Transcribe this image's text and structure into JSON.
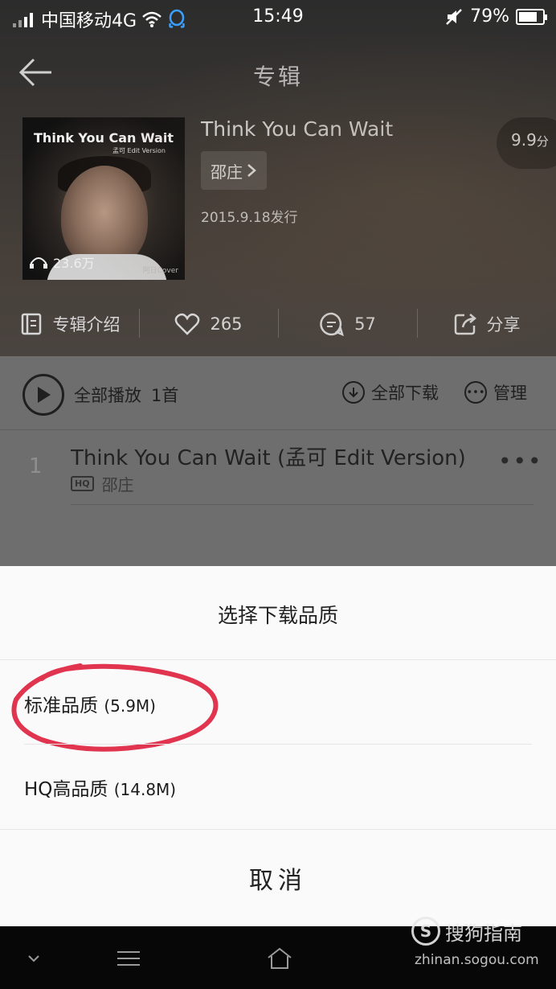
{
  "status_bar": {
    "carrier": "中国移动4G",
    "time": "15:49",
    "battery": "79%",
    "battery_level": 0.79
  },
  "header": {
    "title": "专辑"
  },
  "album": {
    "cover_title": "Think You Can Wait",
    "cover_subtitle": "孟可 Edit Version",
    "cover_mark": "阿日Cover",
    "play_count": "23.6万",
    "name": "Think You Can Wait",
    "artist": "邵庄",
    "release": "2015.9.18发行",
    "score": "9.9",
    "score_unit": "分"
  },
  "actions": {
    "intro": "专辑介绍",
    "likes": "265",
    "comments": "57",
    "share": "分享"
  },
  "list": {
    "play_all": "全部播放",
    "count": "1首",
    "download_all": "全部下载",
    "manage": "管理",
    "tracks": [
      {
        "num": "1",
        "title": "Think You Can Wait (孟可 Edit Version)",
        "quality_badge": "HQ",
        "artist": "邵庄"
      }
    ]
  },
  "sheet": {
    "title": "选择下载品质",
    "options": [
      {
        "label": "标准品质",
        "size": "(5.9M)"
      },
      {
        "label": "HQ高品质",
        "size": "(14.8M)"
      }
    ],
    "cancel": "取消",
    "highlight_color": "#e0344f"
  },
  "watermark": {
    "text": "搜狗指南",
    "url": "zhinan.sogou.com"
  }
}
